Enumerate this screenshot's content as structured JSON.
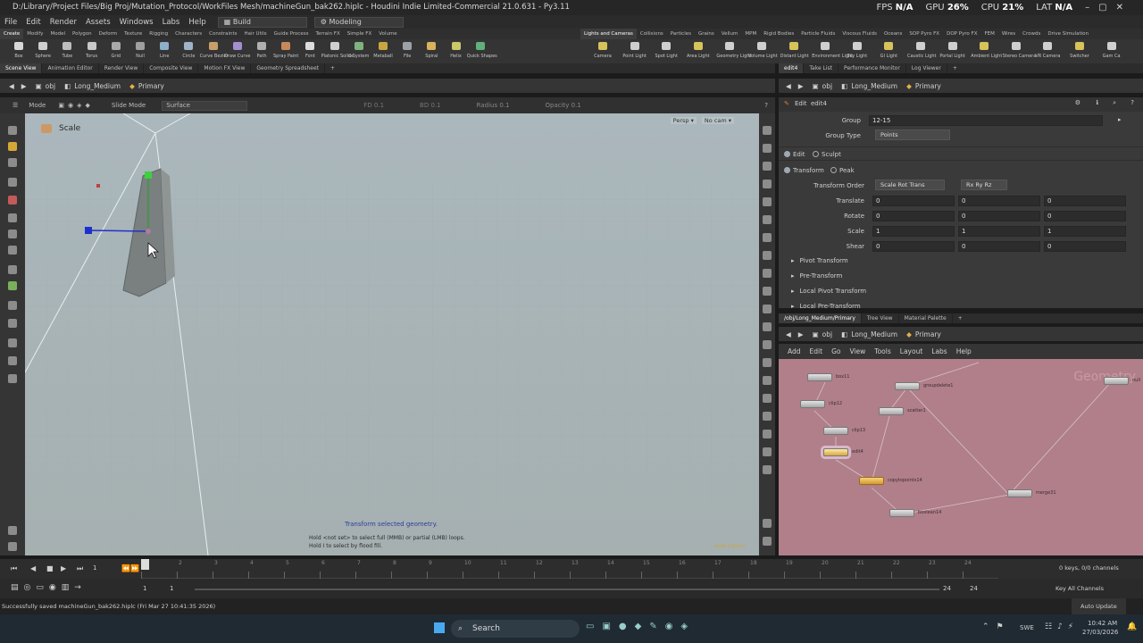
{
  "window": {
    "title": "D:/Library/Project Files/Big Proj/Mutation_Protocol/WorkFiles Mesh/machineGun_bak262.hiplc - Houdini Indie Limited-Commercial 21.0.631 - Py3.11",
    "fps_label": "FPS",
    "fps_value": "N/A",
    "gpu_label": "GPU",
    "gpu_value": "26%",
    "cpu_label": "CPU",
    "cpu_value": "21%",
    "lat_label": "LAT",
    "lat_value": "N/A"
  },
  "menubar": {
    "items": [
      "File",
      "Edit",
      "Render",
      "Assets",
      "Windows",
      "Labs",
      "Help"
    ],
    "desktop": "Build",
    "context": "Modeling"
  },
  "shelf_tabs_left": [
    "Create",
    "Modify",
    "Model",
    "Polygon",
    "Deform",
    "Texture",
    "Rigging",
    "Characters",
    "Constraints",
    "Hair Utils",
    "Guide Process",
    "Terrain FX",
    "Simple FX",
    "Volume"
  ],
  "shelf_tabs_right": [
    "Lights and Cameras",
    "Collisions",
    "Particles",
    "Grains",
    "Vellum",
    "MPM",
    "Rigid Bodies",
    "Particle Fluids",
    "Viscous Fluids",
    "Oceans",
    "SOP Pyro FX",
    "DOP Pyro FX",
    "FEM",
    "Wires",
    "Crowds",
    "Drive Simulation"
  ],
  "tools_left": [
    "Box",
    "Sphere",
    "Tube",
    "Torus",
    "Grid",
    "Null",
    "Line",
    "Circle",
    "Curve Bezier",
    "Draw Curve",
    "Path",
    "Spray Paint",
    "Font",
    "Platonic Solids",
    "L-System",
    "Metaball",
    "File",
    "Spiral",
    "Helix",
    "Quick Shapes"
  ],
  "tools_right": [
    "Camera",
    "Point Light",
    "Spot Light",
    "Area Light",
    "Geometry Light",
    "Volume Light",
    "Distant Light",
    "Environment Light",
    "Sky Light",
    "GI Light",
    "Caustic Light",
    "Portal Light",
    "Ambient Light",
    "Stereo Camera",
    "VR Camera",
    "Switcher",
    "Gam Ca"
  ],
  "left_pane_tabs": [
    "Scene View",
    "Animation Editor",
    "Render View",
    "Composite View",
    "Motion FX View",
    "Geometry Spreadsheet"
  ],
  "right_top_tabs": [
    "edit4",
    "Take List",
    "Performance Monitor",
    "Log Viewer"
  ],
  "path": {
    "root": "obj",
    "object": "Long_Medium",
    "network": "Primary"
  },
  "viewport_toolbar": {
    "mode_label": "Mode",
    "slide_mode": "Slide Mode",
    "surface": "Surface",
    "fd": "FD",
    "bd": "BD",
    "radius": "Radius",
    "opacity": "Opacity",
    "dim_values": [
      "0.1",
      "0.1",
      "0.1",
      "0.1"
    ]
  },
  "viewport": {
    "tool_name": "Scale",
    "persp": "Persp",
    "camera": "No cam",
    "hint_title": "Transform selected geometry.",
    "hint_line1": "Hold <not set> to select full (MMB) or partial (LMB) loops.",
    "hint_line2": "Hold I to select by flood fill.",
    "corner_text": "Indie Edition"
  },
  "params": {
    "node_type": "Edit",
    "node_name": "edit4",
    "group_label": "Group",
    "group_value": "12-15",
    "group_type_label": "Group Type",
    "group_type_value": "Points",
    "mode_edit": "Edit",
    "mode_sculpt": "Sculpt",
    "op_transform": "Transform",
    "op_peak": "Peak",
    "transform_order_label": "Transform Order",
    "transform_order_value": "Scale Rot Trans",
    "rot_order_value": "Rx Ry Rz",
    "rows": [
      {
        "label": "Translate",
        "values": [
          "0",
          "0",
          "0"
        ]
      },
      {
        "label": "Rotate",
        "values": [
          "0",
          "0",
          "0"
        ]
      },
      {
        "label": "Scale",
        "values": [
          "1",
          "1",
          "1"
        ]
      },
      {
        "label": "Shear",
        "values": [
          "0",
          "0",
          "0"
        ]
      }
    ],
    "sections": [
      "Pivot Transform",
      "Pre-Transform",
      "Local Pivot Transform",
      "Local Pre-Transform"
    ]
  },
  "network_tabs": [
    "/obj/Long_Medium/Primary",
    "Tree View",
    "Material Palette"
  ],
  "network_menu": [
    "Add",
    "Edit",
    "Go",
    "View",
    "Tools",
    "Layout",
    "Labs",
    "Help"
  ],
  "network": {
    "watermark": "Geometry",
    "nodes": [
      {
        "name": "box11",
        "state": "normal"
      },
      {
        "name": "groupdelete1",
        "state": "normal"
      },
      {
        "name": "clip12",
        "state": "normal"
      },
      {
        "name": "scatter1",
        "state": "normal"
      },
      {
        "name": "clip13",
        "state": "normal"
      },
      {
        "name": "edit4",
        "state": "selected"
      },
      {
        "name": "copytopoints14",
        "state": "orange"
      },
      {
        "name": "merge31",
        "state": "normal"
      },
      {
        "name": "boolean14",
        "state": "normal"
      },
      {
        "name": "null",
        "state": "normal"
      }
    ]
  },
  "timeline": {
    "frame": "1",
    "ticks": [
      "1",
      "2",
      "3",
      "4",
      "5",
      "6",
      "7",
      "8",
      "9",
      "10",
      "11",
      "12",
      "13",
      "14",
      "15",
      "16",
      "17",
      "18",
      "19",
      "20",
      "21",
      "22",
      "23",
      "24"
    ],
    "start": "1",
    "range_start": "1",
    "range_end": "24",
    "end": "24",
    "keys_info": "0 keys, 0/0 channels",
    "key_all": "Key All Channels",
    "auto_update": "Auto Update"
  },
  "status_message": "Successfully saved machineGun_bak262.hiplc (Fri Mar 27 10:41:35 2026)",
  "taskbar": {
    "search": "Search",
    "lang": "SWE",
    "time": "10:42 AM",
    "date": "27/03/2026"
  },
  "colors": {
    "accent_blue": "#2e6fa8",
    "network_bg": "#b07f8a",
    "viewport_bg": "#a8b4b7",
    "node_orange": "#e0a83c"
  }
}
